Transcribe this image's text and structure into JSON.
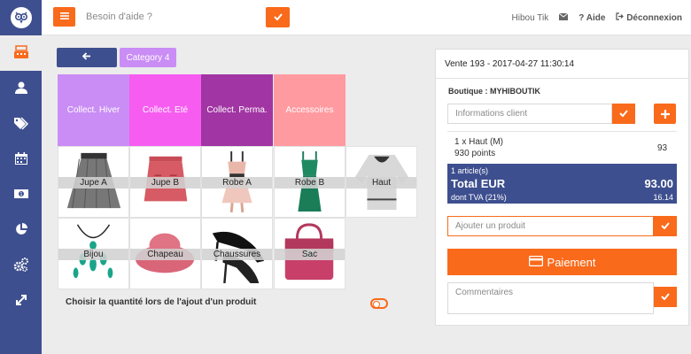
{
  "topbar": {
    "help_placeholder": "Besoin d'aide ?",
    "user": "Hibou Tik",
    "help_link": "Aide",
    "logout": "Déconnexion"
  },
  "categories": {
    "current": "Category 4",
    "tiles": [
      {
        "label": "Collect. Hiver",
        "color": "#c98df5"
      },
      {
        "label": "Collect. Eté",
        "color": "#f75cf0"
      },
      {
        "label": "Collect. Perma.",
        "color": "#a135a3"
      },
      {
        "label": "Accessoires",
        "color": "#ff9aa0"
      }
    ]
  },
  "products": [
    "Jupe A",
    "Jupe B",
    "Robe A",
    "Robe B",
    "Haut",
    "Bijou",
    "Chapeau",
    "Chaussures",
    "Sac"
  ],
  "options": {
    "qty_label": "Choisir la quantité lors de l'ajout d'un produit"
  },
  "sale": {
    "title": "Vente 193 - 2017-04-27 11:30:14",
    "shop": "Boutique : MYHIBOUTIK",
    "client_placeholder": "Informations client",
    "line": {
      "name": "1 x Haut (M)",
      "points": "930 points",
      "price": "93"
    },
    "articles": "1 article(s)",
    "total_label": "Total EUR",
    "total_value": "93.00",
    "tva_label": "dont TVA (21%)",
    "tva_value": "16.14",
    "add_placeholder": "Ajouter un produit",
    "pay_label": "Paiement",
    "comment_placeholder": "Commentaires"
  },
  "colors": {
    "accent": "#f96a1b",
    "brand": "#3e4f8f"
  }
}
